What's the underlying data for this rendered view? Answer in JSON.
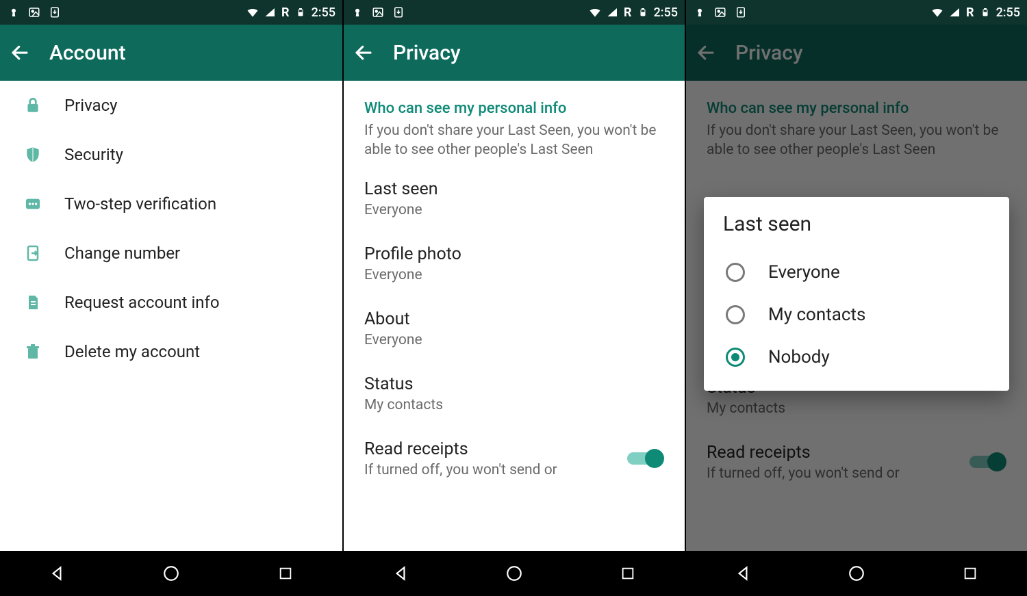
{
  "status": {
    "time": "2:55",
    "roaming": "R"
  },
  "panel1": {
    "title": "Account",
    "items": [
      {
        "label": "Privacy"
      },
      {
        "label": "Security"
      },
      {
        "label": "Two-step verification"
      },
      {
        "label": "Change number"
      },
      {
        "label": "Request account info"
      },
      {
        "label": "Delete my account"
      }
    ]
  },
  "panel2": {
    "title": "Privacy",
    "section_title": "Who can see my personal info",
    "section_sub": "If you don't share your Last Seen, you won't be able to see other people's Last Seen",
    "prefs": [
      {
        "title": "Last seen",
        "value": "Everyone"
      },
      {
        "title": "Profile photo",
        "value": "Everyone"
      },
      {
        "title": "About",
        "value": "Everyone"
      },
      {
        "title": "Status",
        "value": "My contacts"
      }
    ],
    "read_receipts": {
      "title": "Read receipts",
      "sub": "If turned off, you won't send or",
      "on": true
    }
  },
  "panel3": {
    "title": "Privacy",
    "section_title": "Who can see my personal info",
    "section_sub": "If you don't share your Last Seen, you won't be able to see other people's Last Seen",
    "status_pref": {
      "title": "Status",
      "value": "My contacts"
    },
    "read_receipts": {
      "title": "Read receipts",
      "sub": "If turned off, you won't send or",
      "on": true
    },
    "dialog": {
      "title": "Last seen",
      "options": [
        {
          "label": "Everyone",
          "selected": false
        },
        {
          "label": "My contacts",
          "selected": false
        },
        {
          "label": "Nobody",
          "selected": true
        }
      ]
    }
  }
}
